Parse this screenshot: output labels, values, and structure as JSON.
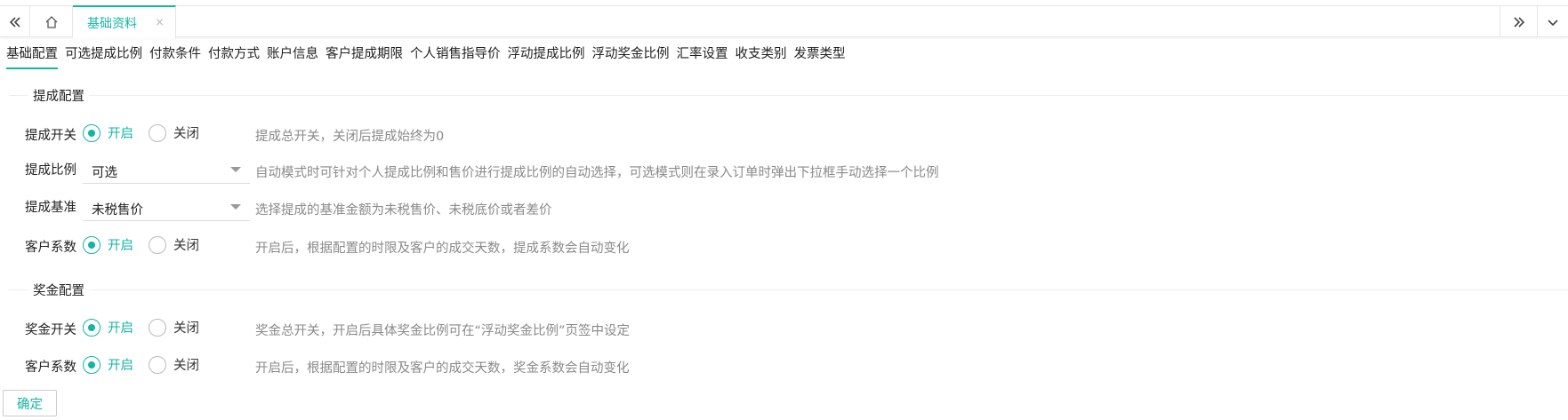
{
  "topbar": {
    "collapse_icon": "double-chevron-left-icon",
    "home_icon": "home-icon",
    "tab_label": "基础资料",
    "tab_close": "×",
    "expand_icon": "double-chevron-right-icon",
    "menu_icon": "chevron-down-icon"
  },
  "subtabs": [
    "基础配置",
    "可选提成比例",
    "付款条件",
    "付款方式",
    "账户信息",
    "客户提成期限",
    "个人销售指导价",
    "浮动提成比例",
    "浮动奖金比例",
    "汇率设置",
    "收支类别",
    "发票类型"
  ],
  "active_subtab": "基础配置",
  "commission": {
    "title": "提成配置",
    "switch": {
      "label": "提成开关",
      "on": "开启",
      "off": "关闭",
      "selected": "开启",
      "hint": "提成总开关，关闭后提成始终为0"
    },
    "ratio": {
      "label": "提成比例",
      "value": "可选",
      "hint": "自动模式时可针对个人提成比例和售价进行提成比例的自动选择，可选模式则在录入订单时弹出下拉框手动选择一个比例"
    },
    "base": {
      "label": "提成基准",
      "value": "未税售价",
      "hint": "选择提成的基准金额为未税售价、未税底价或者差价"
    },
    "customer_factor": {
      "label": "客户系数",
      "on": "开启",
      "off": "关闭",
      "selected": "开启",
      "hint": "开启后，根据配置的时限及客户的成交天数，提成系数会自动变化"
    }
  },
  "bonus": {
    "title": "奖金配置",
    "switch": {
      "label": "奖金开关",
      "on": "开启",
      "off": "关闭",
      "selected": "开启",
      "hint": "奖金总开关，开启后具体奖金比例可在“浮动奖金比例”页签中设定"
    },
    "customer_factor": {
      "label": "客户系数",
      "on": "开启",
      "off": "关闭",
      "selected": "开启",
      "hint": "开启后，根据配置的时限及客户的成交天数，奖金系数会自动变化"
    }
  },
  "confirm_label": "确定",
  "accent_color": "#13b5a5"
}
